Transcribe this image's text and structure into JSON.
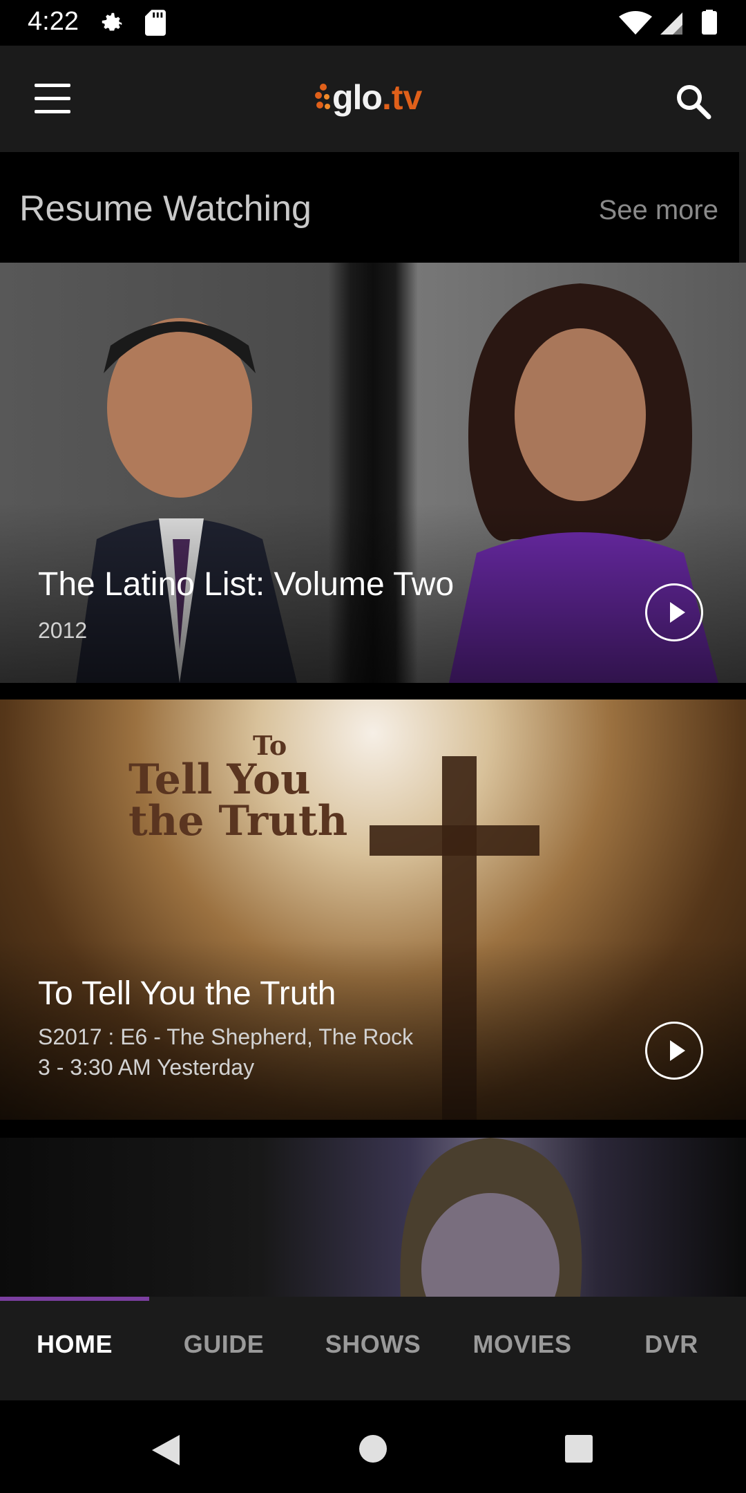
{
  "status_bar": {
    "time": "4:22",
    "icons": [
      "settings-icon",
      "sd-card-icon",
      "wifi-icon",
      "signal-icon",
      "battery-icon"
    ]
  },
  "app_bar": {
    "logo_main": "glo",
    "logo_dot": ".",
    "logo_suffix": "tv",
    "brand_color": "#e0601a"
  },
  "section": {
    "title": "Resume Watching",
    "see_more": "See more"
  },
  "cards": [
    {
      "title": "The Latino List: Volume Two",
      "subtitle": "2012"
    },
    {
      "art_line1": "To",
      "art_line2": "Tell You",
      "art_line3": "the Truth",
      "title": "To Tell You the Truth",
      "subtitle_line1": "S2017 : E6 - The Shepherd, The Rock",
      "subtitle_line2": "3 - 3:30 AM Yesterday"
    },
    {}
  ],
  "tabs": [
    {
      "label": "HOME",
      "active": true
    },
    {
      "label": "GUIDE",
      "active": false
    },
    {
      "label": "SHOWS",
      "active": false
    },
    {
      "label": "MOVIES",
      "active": false
    },
    {
      "label": "DVR",
      "active": false
    }
  ],
  "colors": {
    "accent": "#7b3fa0",
    "appbar_bg": "#1b1b1b"
  }
}
